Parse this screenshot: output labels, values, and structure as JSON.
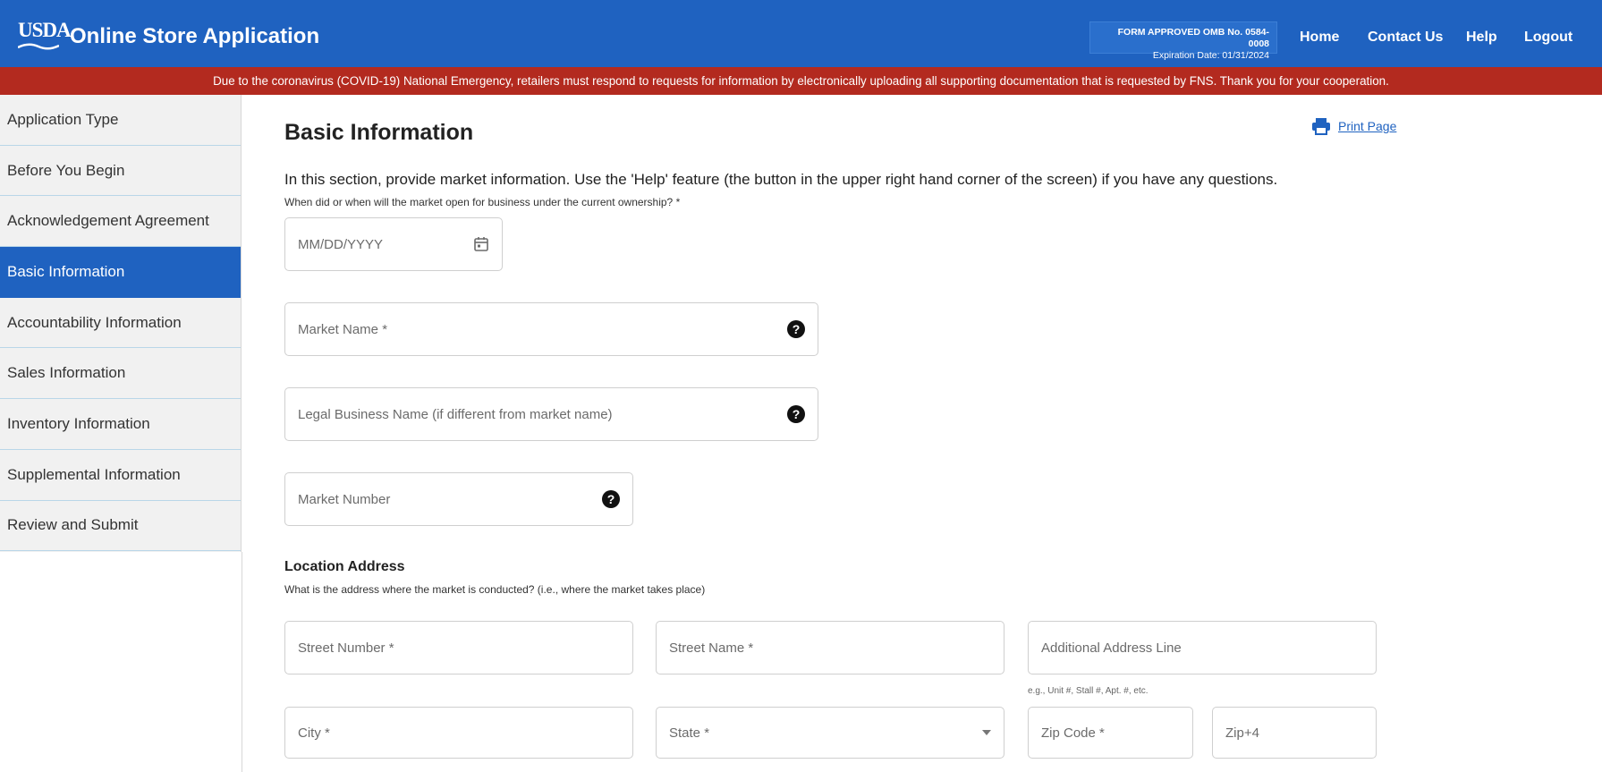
{
  "header": {
    "logo_text": "USDA",
    "app_title": "Online Store Application",
    "omb_line1": "FORM APPROVED OMB No. 0584-0008",
    "omb_line2": "Expiration Date: 01/31/2024",
    "nav": [
      "Home",
      "Contact Us",
      "Help",
      "Logout"
    ],
    "brand_color": "#1f62c0"
  },
  "banner": {
    "text": "Due to the coronavirus (COVID-19) National Emergency, retailers must respond to requests for information by electronically uploading all supporting documentation that is requested by FNS. Thank you for your cooperation.",
    "color": "#b32a1f"
  },
  "sidebar": {
    "items": [
      {
        "label": "Application Type"
      },
      {
        "label": "Before You Begin"
      },
      {
        "label": "Acknowledgement Agreement"
      },
      {
        "label": "Basic Information",
        "active": true
      },
      {
        "label": "Accountability Information"
      },
      {
        "label": "Sales Information"
      },
      {
        "label": "Inventory Information"
      },
      {
        "label": "Supplemental Information"
      },
      {
        "label": "Review and Submit"
      }
    ]
  },
  "main": {
    "title": "Basic Information",
    "print_label": "Print Page",
    "intro": "In this section, provide market information. Use the 'Help' feature (the button in the upper right hand corner of the screen) if you have any questions.",
    "open_question": "When did or when will the market open for business under the current ownership? *",
    "date_placeholder": "MM/DD/YYYY",
    "market_name": "Market Name *",
    "legal_name": "Legal Business Name (if different from market name)",
    "market_number": "Market Number",
    "location": {
      "heading": "Location Address",
      "sub": "What is the address where the market is conducted? (i.e., where the market takes place)",
      "street_number": "Street Number *",
      "street_name": "Street Name *",
      "additional_line": "Additional Address Line",
      "additional_hint": "e.g., Unit #, Stall #, Apt. #, etc.",
      "city": "City *",
      "state": "State *",
      "zip": "Zip Code *",
      "zip4": "Zip+4"
    }
  }
}
